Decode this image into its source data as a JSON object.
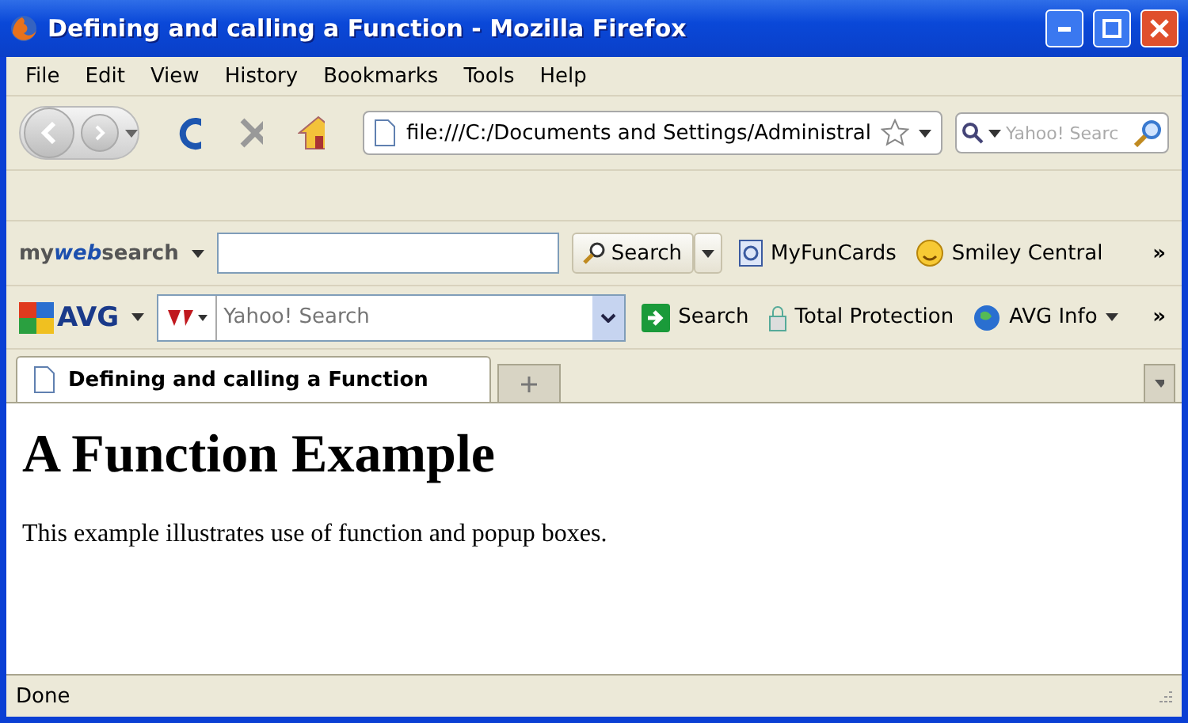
{
  "window": {
    "title": "Defining and calling a Function - Mozilla Firefox"
  },
  "menu": [
    "File",
    "Edit",
    "View",
    "History",
    "Bookmarks",
    "Tools",
    "Help"
  ],
  "address": {
    "value": "file:///C:/Documents and Settings/Administral"
  },
  "search_box": {
    "placeholder": "Yahoo! Searc"
  },
  "mywebsearch": {
    "brand_pre": "my",
    "brand_mid": "web",
    "brand_post": "search",
    "button": "Search",
    "links": [
      "MyFunCards",
      "Smiley Central"
    ],
    "more": "»"
  },
  "avg": {
    "brand": "AVG",
    "placeholder": "Yahoo! Search",
    "search": "Search",
    "protection": "Total Protection",
    "info": "AVG Info",
    "more": "»"
  },
  "tabs": [
    {
      "label": "Defining and calling a Function",
      "selected": true
    }
  ],
  "page": {
    "heading": "A Function Example",
    "paragraph": "This example illustrates use of function and popup boxes."
  },
  "status_bar": {
    "text": "Done"
  }
}
